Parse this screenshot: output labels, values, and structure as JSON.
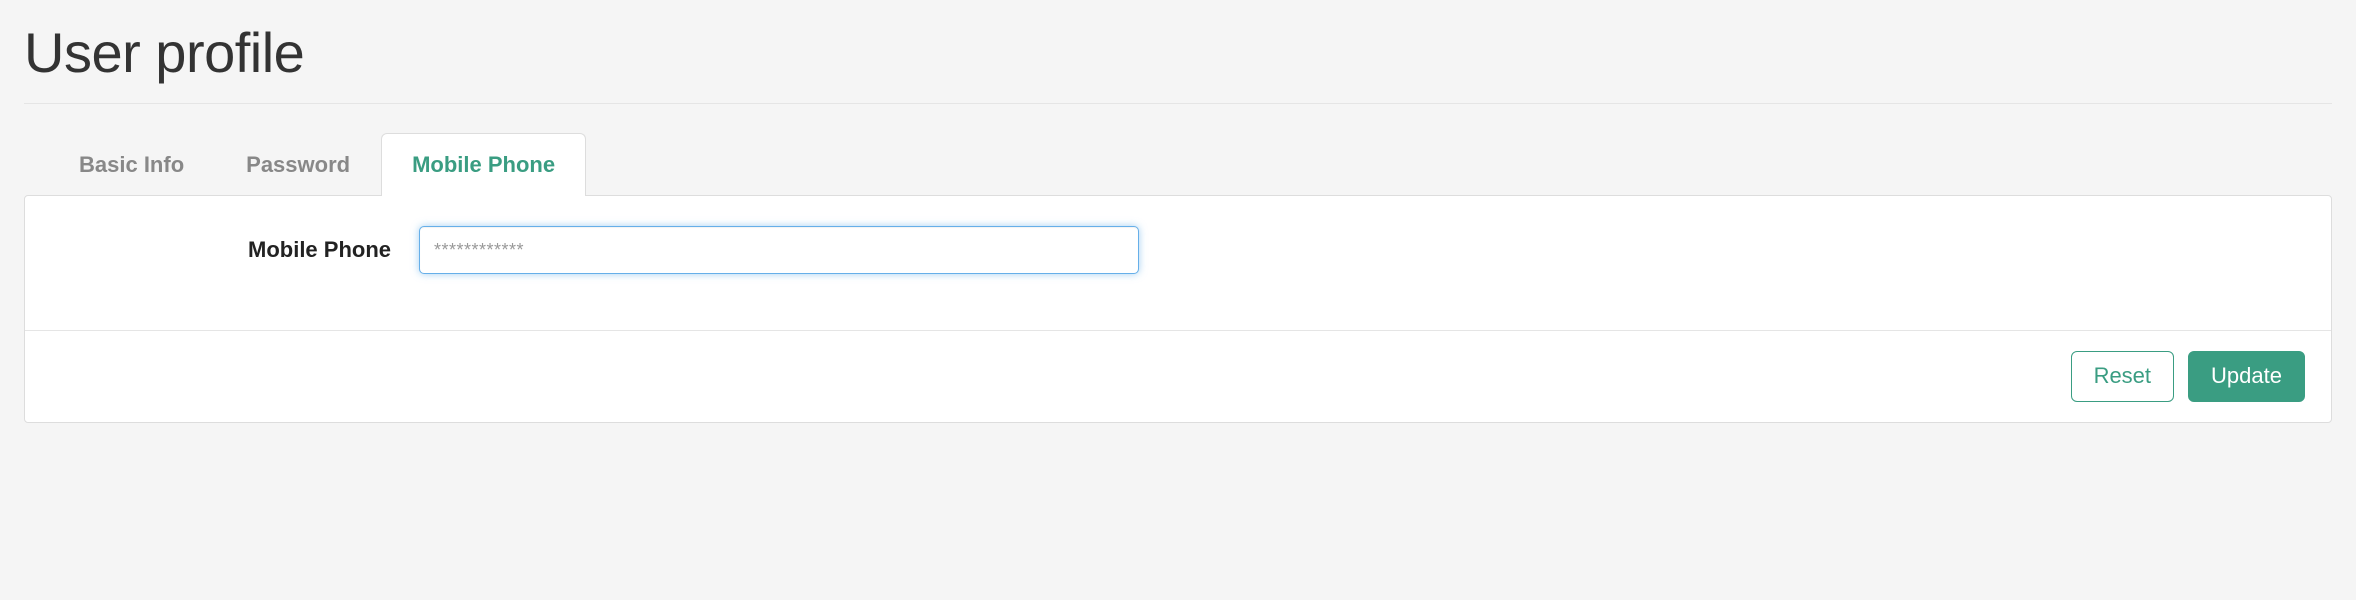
{
  "page": {
    "title": "User profile"
  },
  "tabs": [
    {
      "label": "Basic Info",
      "active": false
    },
    {
      "label": "Password",
      "active": false
    },
    {
      "label": "Mobile Phone",
      "active": true
    }
  ],
  "form": {
    "mobile_phone": {
      "label": "Mobile Phone",
      "placeholder": "************",
      "value": ""
    }
  },
  "buttons": {
    "reset": "Reset",
    "update": "Update"
  },
  "colors": {
    "accent": "#3a9d82",
    "focus_border": "#66afe9"
  }
}
